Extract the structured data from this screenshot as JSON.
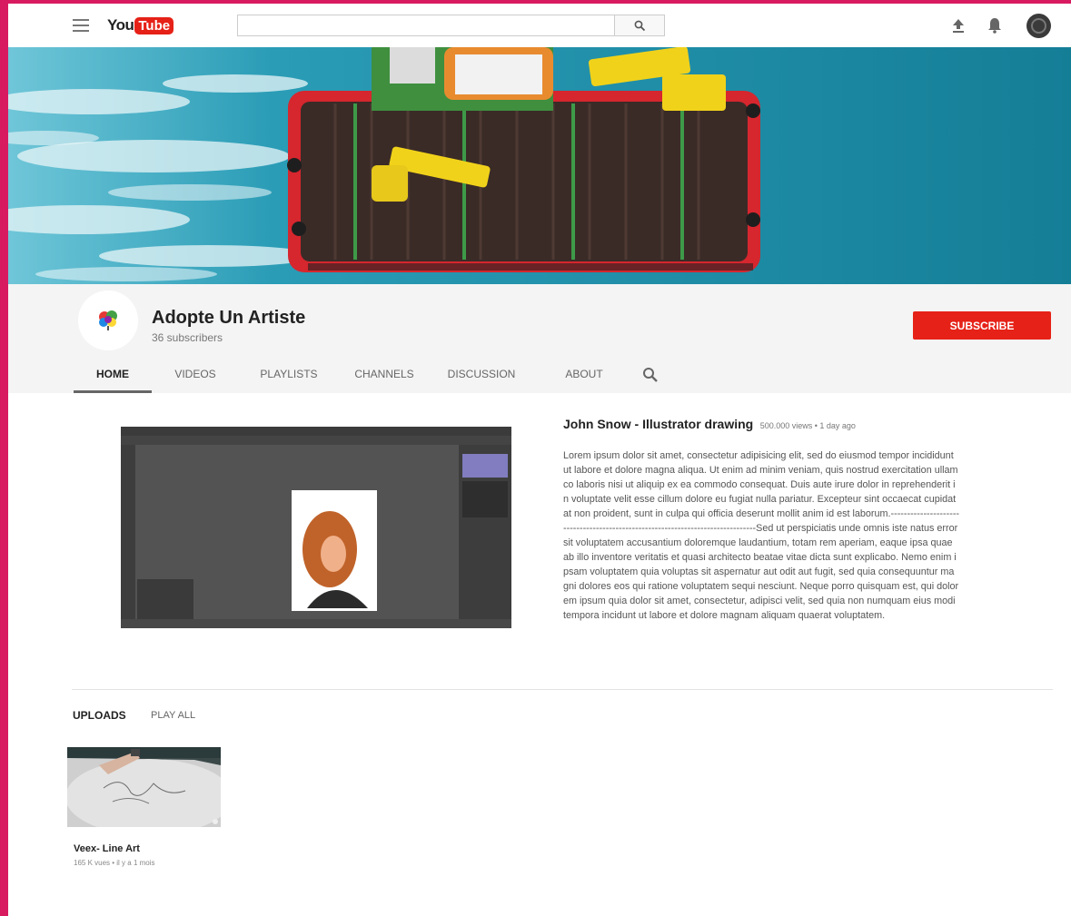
{
  "header": {
    "logo_you": "You",
    "logo_tube": "Tube",
    "search": {
      "placeholder": ""
    },
    "icons": [
      "menu-icon",
      "search-icon",
      "upload-icon",
      "bell-icon",
      "avatar"
    ]
  },
  "channel": {
    "name": "Adopte Un Artiste",
    "subscribers": "36 subscribers",
    "subscribe_label": "SUBSCRIBE",
    "tabs": [
      {
        "label": "HOME",
        "active": true
      },
      {
        "label": "VIDEOS",
        "active": false
      },
      {
        "label": "PLAYLISTS",
        "active": false
      },
      {
        "label": "CHANNELS",
        "active": false
      },
      {
        "label": "DISCUSSION",
        "active": false
      },
      {
        "label": "ABOUT",
        "active": false
      }
    ]
  },
  "featured": {
    "title": "John Snow - Illustrator drawing",
    "meta": "500.000 views • 1 day ago",
    "description": "Lorem ipsum dolor sit amet, consectetur adipisicing elit, sed do eiusmod tempor incididunt ut labore et dolore magna aliqua. Ut enim ad minim veniam, quis nostrud exercitation ullamco laboris nisi ut aliquip ex ea commodo consequat. Duis aute irure dolor in reprehenderit in voluptate velit esse cillum dolore eu fugiat nulla pariatur. Excepteur sint occaecat cupidatat non proident, sunt in culpa qui officia deserunt mollit anim id est laborum.--------------------------------------------------------------------------------Sed ut perspiciatis unde omnis iste natus error sit voluptatem accusantium doloremque laudantium, totam rem aperiam, eaque ipsa quae ab illo inventore veritatis et quasi architecto beatae vitae dicta sunt explicabo. Nemo enim ipsam voluptatem quia voluptas sit aspernatur aut odit aut fugit, sed quia consequuntur magni dolores eos qui ratione voluptatem sequi nesciunt. Neque porro quisquam est, qui dolorem ipsum quia dolor sit amet, consectetur, adipisci velit, sed quia non numquam eius modi tempora incidunt ut labore et dolore magnam aliquam quaerat voluptatem."
  },
  "uploads": {
    "title": "UPLOADS",
    "play_all": "PLAY ALL",
    "items": [
      {
        "title": "Veex- Line Art",
        "meta": "165 K vues • il y a 1 mois"
      }
    ]
  },
  "colors": {
    "frame": "#d81b60",
    "subscribe": "#e62117",
    "sea": "#1a8aa3"
  }
}
